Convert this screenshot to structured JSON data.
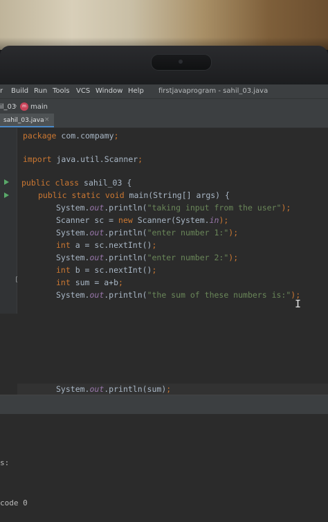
{
  "menu": {
    "items": [
      "r",
      "Build",
      "Run",
      "Tools",
      "VCS",
      "Window",
      "Help"
    ],
    "title": "firstjavaprogram - sahil_03.java"
  },
  "breadcrumb": {
    "file": "il_03",
    "method": "main"
  },
  "tab": {
    "label": "sahil_03.java",
    "close": "×"
  },
  "code": {
    "l1": [
      "package",
      " com.compamy",
      ";"
    ],
    "l2": [
      "import",
      " java.util.Scanner",
      ";"
    ],
    "l3": [
      "public class",
      " sahil_03 {"
    ],
    "l4": [
      "public static void",
      " main(String[] args) {"
    ],
    "l5": [
      "System.",
      "out",
      ".println(",
      "\"taking input from the user\"",
      ");"
    ],
    "l6": [
      "Scanner sc = ",
      "new",
      " Scanner(System.",
      "in",
      ");"
    ],
    "l7": [
      "System.",
      "out",
      ".println(",
      "\"enter number 1:\"",
      ");"
    ],
    "l8": [
      "int",
      " a = sc.nextInt()",
      ";"
    ],
    "l9": [
      "System.",
      "out",
      ".println(",
      "\"enter number 2:\"",
      ");"
    ],
    "l10": [
      "int",
      " b = sc.nextInt()",
      ";"
    ],
    "l11": [
      "int",
      " sum = a+b",
      ";"
    ],
    "l12": [
      "System.",
      "out",
      ".println(",
      "\"the sum of these numbers is:\"",
      ");"
    ],
    "l13": [
      "System.",
      "out",
      ".println(sum)",
      ";"
    ]
  },
  "console": {
    "line1": "s:",
    "line2": "code 0"
  },
  "colors": {
    "keyword": "#cc7832",
    "string": "#6a8759",
    "field": "#9876aa",
    "text": "#a9b7c6",
    "background": "#2b2b2b"
  }
}
